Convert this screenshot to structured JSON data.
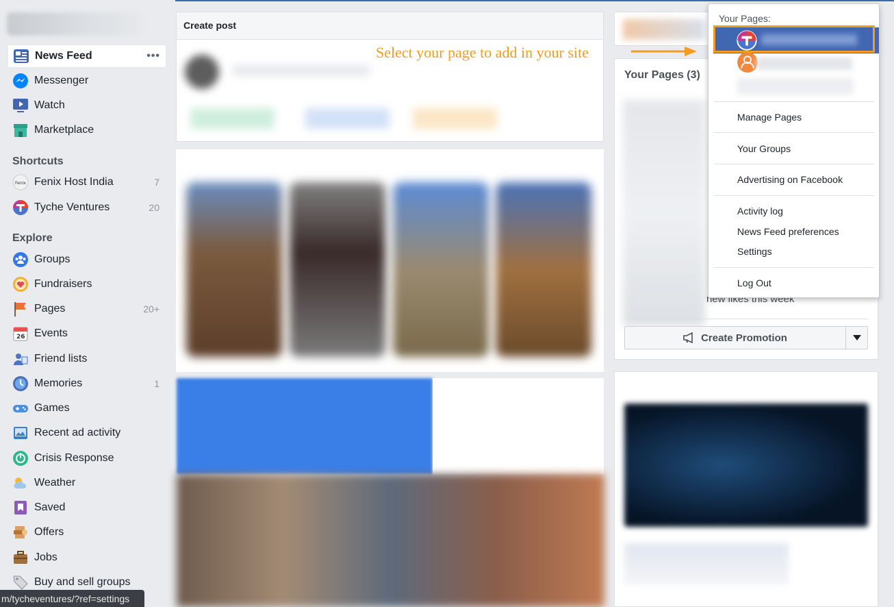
{
  "sidebar": {
    "nav": [
      {
        "label": "News Feed",
        "icon": "news-feed-icon",
        "active": true,
        "more": "•••"
      },
      {
        "label": "Messenger",
        "icon": "messenger-icon"
      },
      {
        "label": "Watch",
        "icon": "watch-icon"
      },
      {
        "label": "Marketplace",
        "icon": "marketplace-icon"
      }
    ],
    "shortcuts_title": "Shortcuts",
    "shortcuts": [
      {
        "label": "Fenix Host India",
        "count": "7",
        "icon": "fenix-host-logo-icon"
      },
      {
        "label": "Tyche Ventures",
        "count": "20",
        "icon": "tyche-ventures-logo-icon"
      }
    ],
    "explore_title": "Explore",
    "explore": [
      {
        "label": "Groups",
        "count": "",
        "icon": "groups-icon"
      },
      {
        "label": "Fundraisers",
        "count": "",
        "icon": "fundraisers-icon"
      },
      {
        "label": "Pages",
        "count": "20+",
        "icon": "pages-flag-icon"
      },
      {
        "label": "Events",
        "count": "",
        "icon": "events-calendar-icon",
        "badge": "26"
      },
      {
        "label": "Friend lists",
        "count": "",
        "icon": "friend-lists-icon"
      },
      {
        "label": "Memories",
        "count": "1",
        "icon": "memories-clock-icon"
      },
      {
        "label": "Games",
        "count": "",
        "icon": "games-controller-icon"
      },
      {
        "label": "Recent ad activity",
        "count": "",
        "icon": "recent-ad-activity-icon"
      },
      {
        "label": "Crisis Response",
        "count": "",
        "icon": "crisis-response-icon"
      },
      {
        "label": "Weather",
        "count": "",
        "icon": "weather-icon"
      },
      {
        "label": "Saved",
        "count": "",
        "icon": "saved-bookmark-icon"
      },
      {
        "label": "Offers",
        "count": "",
        "icon": "offers-icon"
      },
      {
        "label": "Jobs",
        "count": "",
        "icon": "jobs-briefcase-icon"
      },
      {
        "label": "Buy and sell groups",
        "count": "",
        "icon": "buy-sell-tag-icon"
      }
    ]
  },
  "status_url": "m/tycheventures/?ref=settings",
  "create_post": {
    "title": "Create post"
  },
  "annotation": {
    "text": "Select your page to add in your site"
  },
  "right": {
    "pages_card_title": "Your Pages (3)",
    "new_likes_text": "new likes this week",
    "create_promotion": "Create Promotion"
  },
  "dropdown": {
    "title": "Your Pages:",
    "items": [
      "Manage Pages",
      "Your Groups",
      "Advertising on Facebook",
      "Activity log",
      "News Feed preferences",
      "Settings",
      "Log Out"
    ]
  },
  "colors": {
    "brand": "#4267b2",
    "annotation": "#f29c21",
    "messenger": "#0084ff",
    "tyche_red": "#e8412f"
  }
}
